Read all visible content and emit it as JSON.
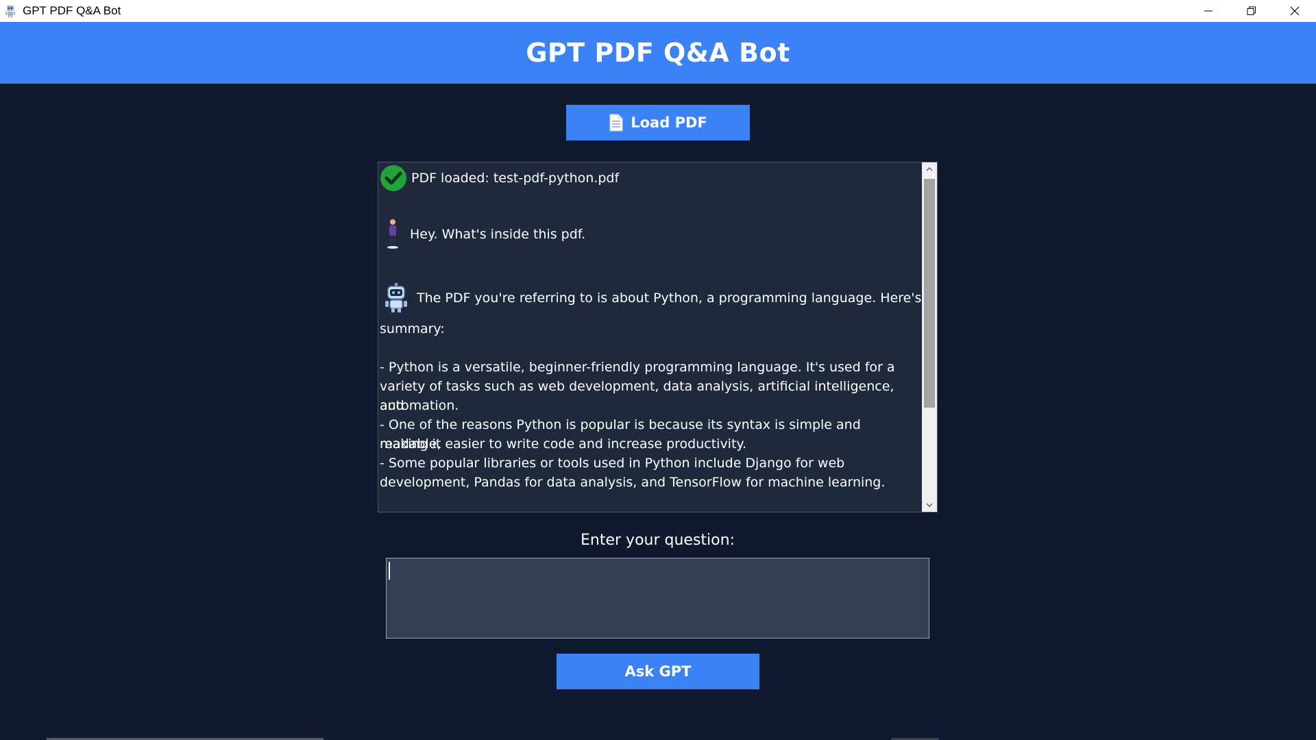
{
  "window": {
    "title": "GPT PDF Q&A Bot",
    "controls": [
      "minimize-icon",
      "restore-icon",
      "close-icon"
    ]
  },
  "header": {
    "title": "GPT PDF Q&A Bot"
  },
  "toolbar": {
    "load_label": "Load PDF",
    "load_icon": "document-icon"
  },
  "chat": {
    "status": {
      "icon": "checkmark-icon",
      "text": "PDF loaded: test-pdf-python.pdf"
    },
    "user_message": {
      "icon": "user-avatar-icon",
      "text": "Hey. What's inside this pdf."
    },
    "bot_message": {
      "icon": "robot-icon",
      "lines": [
        "The PDF you're referring to is about Python, a programming language. Here's a",
        "summary:",
        "",
        "- Python is a versatile, beginner-friendly programming language. It's used for a",
        "variety of tasks such as web development, data analysis, artificial intelligence, and",
        "automation.",
        "- One of the reasons Python is popular is because its syntax is simple and readable,",
        "making it easier to write code and increase productivity.",
        "- Some popular libraries or tools used in Python include Django for web",
        "development, Pandas for data analysis, and TensorFlow for machine learning."
      ]
    }
  },
  "question": {
    "label": "Enter your question:",
    "value": "",
    "placeholder": ""
  },
  "actions": {
    "ask_label": "Ask GPT"
  },
  "colors": {
    "accent": "#3b82f6",
    "background": "#0f1a2e",
    "chat_background": "#1e293b",
    "input_background": "#334155",
    "success": "#22a43a"
  }
}
